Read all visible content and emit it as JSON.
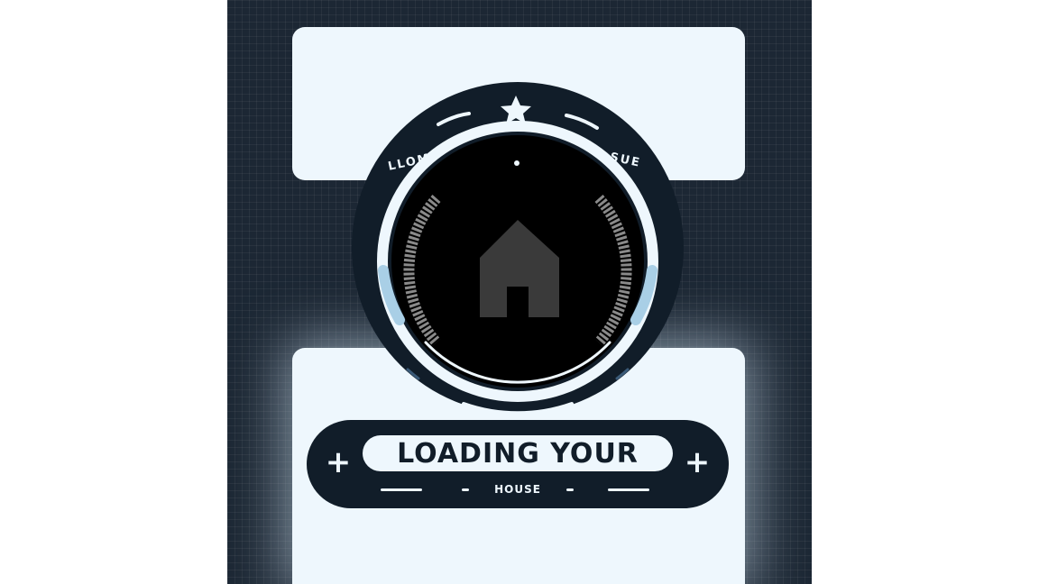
{
  "loader": {
    "ring_label_left": "LLOM",
    "ring_label_right": "I-SUE",
    "title": "LOADING YOUR",
    "subtitle": "HOUSE"
  },
  "icons": {
    "top": "star-icon",
    "center": "house-icon",
    "banner_left": "plus-icon",
    "banner_right": "plus-icon"
  },
  "colors": {
    "background": "#ffffff",
    "panel": "#1c2734",
    "card": "#eef7fd",
    "dial": "#111d29",
    "dial_inner": "#000000",
    "ring_accent": "#a9cfe6",
    "house": "#3a3a3a"
  }
}
